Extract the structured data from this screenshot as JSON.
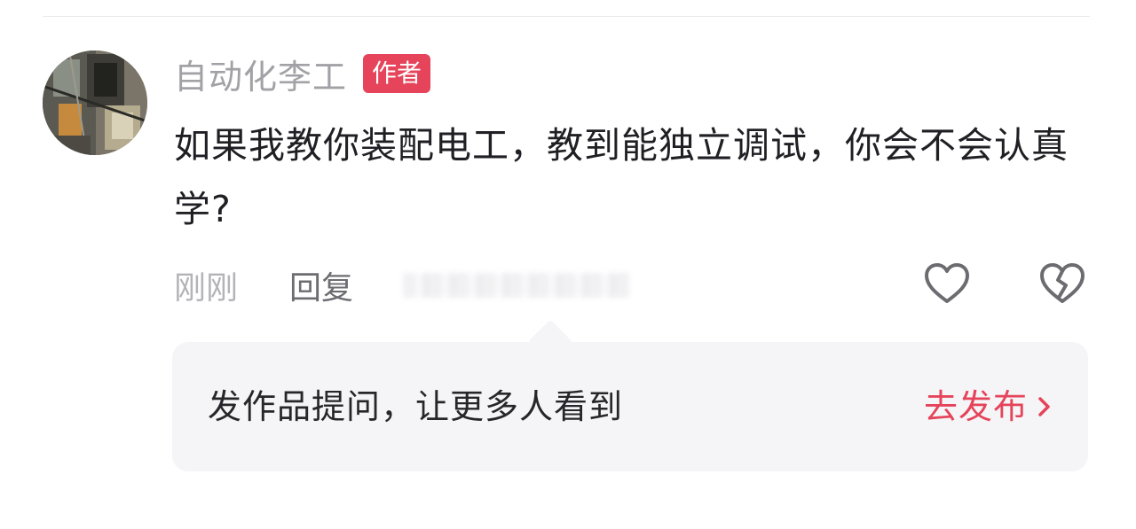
{
  "comment": {
    "author": {
      "name": "自动化李工",
      "badge": "作者"
    },
    "text": "如果我教你装配电工，教到能独立调试，你会不会认真学?",
    "time": "刚刚",
    "reply_label": "回复",
    "actions": {
      "like_icon": "heart-outline-icon",
      "dislike_icon": "broken-heart-icon"
    }
  },
  "tip": {
    "text": "发作品提问，让更多人看到",
    "action_label": "去发布",
    "action_icon": "chevron-right-icon"
  },
  "colors": {
    "accent": "#e5445a",
    "muted_text": "#a2a2a6",
    "body_text": "#1f1f24",
    "tip_background": "#f5f5f7"
  }
}
